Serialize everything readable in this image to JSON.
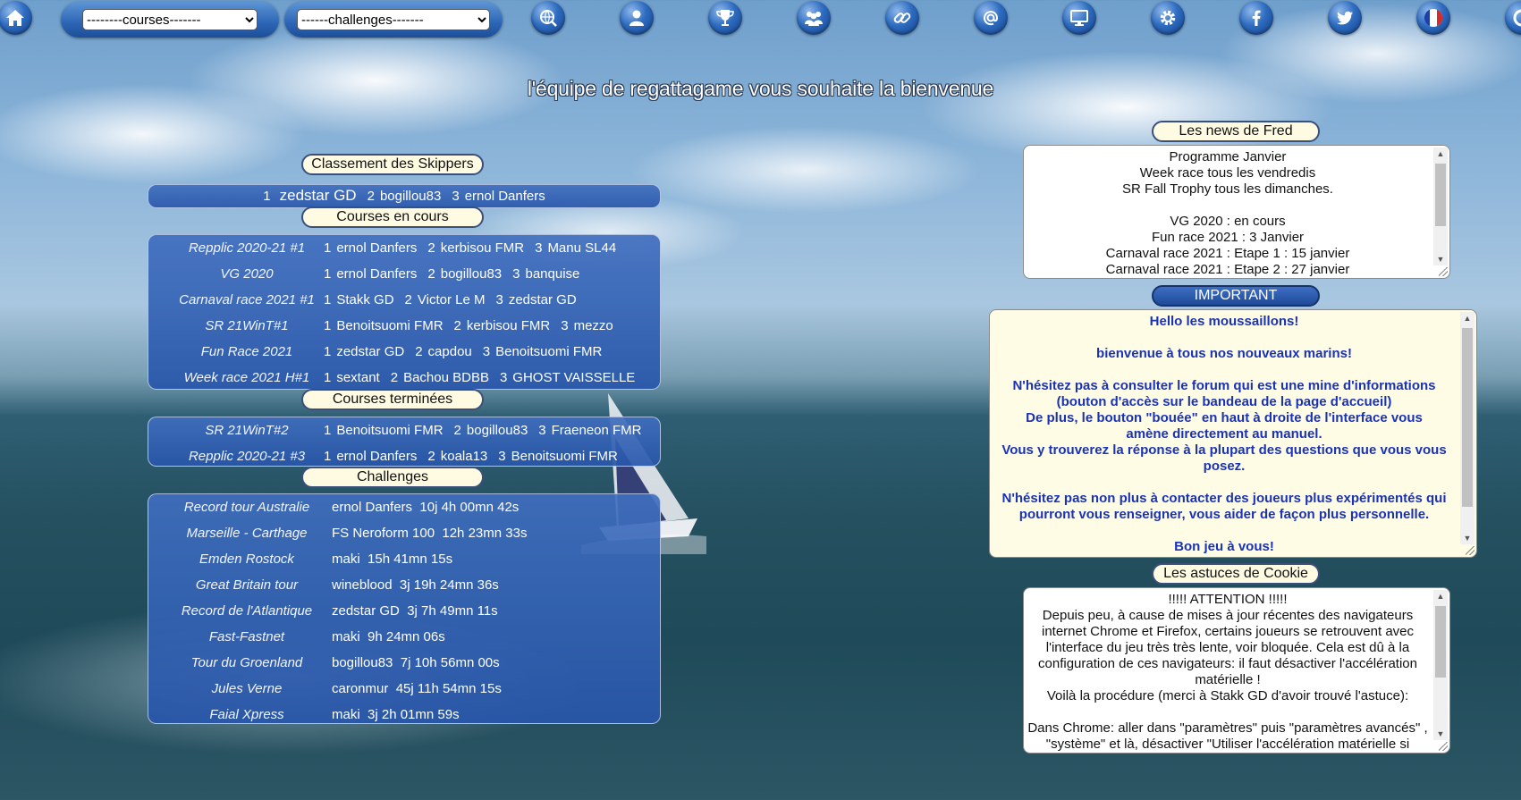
{
  "nav": {
    "courses_select": "--------courses-------",
    "challenges_select": "------challenges-------",
    "icons": [
      "home-icon",
      "search-globe-icon",
      "user-icon",
      "trophy-icon",
      "group-icon",
      "link-icon",
      "at-icon",
      "monitor-icon",
      "gear-icon",
      "facebook-icon",
      "twitter-icon",
      "french-flag-icon"
    ]
  },
  "welcome": "l'équipe de regattagame vous souhaite la bienvenue",
  "left": {
    "classement_title": "Classement des Skippers",
    "skippers": [
      {
        "rank": "1",
        "name": "zedstar GD"
      },
      {
        "rank": "2",
        "name": "bogillou83"
      },
      {
        "rank": "3",
        "name": "ernol Danfers"
      }
    ],
    "courses_title": "Courses en cours",
    "courses": [
      {
        "name": "Repplic 2020-21 #1",
        "results": [
          [
            "1",
            "ernol Danfers"
          ],
          [
            "2",
            "kerbisou FMR"
          ],
          [
            "3",
            "Manu SL44"
          ]
        ]
      },
      {
        "name": "VG 2020",
        "results": [
          [
            "1",
            "ernol Danfers"
          ],
          [
            "2",
            "bogillou83"
          ],
          [
            "3",
            "banquise"
          ]
        ]
      },
      {
        "name": "Carnaval race 2021 #1",
        "results": [
          [
            "1",
            "Stakk GD"
          ],
          [
            "2",
            "Victor Le M"
          ],
          [
            "3",
            "zedstar GD"
          ]
        ]
      },
      {
        "name": "SR 21WinT#1",
        "results": [
          [
            "1",
            "Benoitsuomi FMR"
          ],
          [
            "2",
            "kerbisou FMR"
          ],
          [
            "3",
            "mezzo"
          ]
        ]
      },
      {
        "name": "Fun Race 2021",
        "results": [
          [
            "1",
            "zedstar GD"
          ],
          [
            "2",
            "capdou"
          ],
          [
            "3",
            "Benoitsuomi FMR"
          ]
        ]
      },
      {
        "name": "Week race 2021 H#1",
        "results": [
          [
            "1",
            "sextant"
          ],
          [
            "2",
            "Bachou BDBB"
          ],
          [
            "3",
            "GHOST VAISSELLE"
          ]
        ]
      }
    ],
    "terminees_title": "Courses terminées",
    "terminees": [
      {
        "name": "SR 21WinT#2",
        "results": [
          [
            "1",
            "Benoitsuomi FMR"
          ],
          [
            "2",
            "bogillou83"
          ],
          [
            "3",
            "Fraeneon FMR"
          ]
        ]
      },
      {
        "name": "Repplic 2020-21 #3",
        "results": [
          [
            "1",
            "ernol Danfers"
          ],
          [
            "2",
            "koala13"
          ],
          [
            "3",
            "Benoitsuomi FMR"
          ]
        ]
      }
    ],
    "challenges_title": "Challenges",
    "challenges": [
      {
        "name": "Record tour Australie",
        "result": "ernol Danfers  10j 4h 00mn 42s"
      },
      {
        "name": "Marseille - Carthage",
        "result": "FS Neroform 100  12h 23mn 33s"
      },
      {
        "name": "Emden Rostock",
        "result": "maki  15h 41mn 15s"
      },
      {
        "name": "Great Britain tour",
        "result": "wineblood  3j 19h 24mn 36s"
      },
      {
        "name": "Record de l'Atlantique",
        "result": "zedstar GD  3j 7h 49mn 11s"
      },
      {
        "name": "Fast-Fastnet",
        "result": "maki  9h 24mn 06s"
      },
      {
        "name": "Tour du Groenland",
        "result": "bogillou83  7j 10h 56mn 00s"
      },
      {
        "name": "Jules Verne",
        "result": "caronmur  45j 11h 54mn 15s"
      },
      {
        "name": "Faial Xpress",
        "result": "maki  3j 2h 01mn 59s"
      }
    ]
  },
  "right": {
    "news_title": "Les news de Fred",
    "news_lines": [
      "Programme Janvier",
      "Week race tous les vendredis",
      "SR Fall Trophy tous les dimanches.",
      "",
      "VG 2020 : en cours",
      "Fun race 2021 : 3 Janvier",
      "Carnaval race 2021 : Etape 1 : 15 janvier",
      "Carnaval race 2021 : Etape 2 : 27 janvier"
    ],
    "important_title": "IMPORTANT",
    "important_lines": [
      "Hello les moussaillons!",
      "",
      "bienvenue à tous nos nouveaux marins!",
      "",
      "N'hésitez pas à consulter le forum qui est une mine d'informations",
      "(bouton d'accès sur le bandeau de la page d'accueil)",
      "De plus, le bouton \"bouée\" en haut à droite de l'interface vous",
      "amène directement au manuel.",
      "Vous y trouverez la réponse à la plupart des questions que vous vous",
      "posez.",
      "",
      "N'hésitez pas non plus à contacter des joueurs plus expérimentés qui",
      "pourront vous renseigner, vous aider de façon plus personnelle.",
      "",
      "Bon jeu à vous!"
    ],
    "astuces_title": "Les astuces de Cookie",
    "astuces_lines": [
      "!!!!! ATTENTION !!!!!",
      "Depuis peu, à cause de mises à jour récentes des navigateurs",
      "internet Chrome et Firefox, certains joueurs se retrouvent avec",
      "l'interface du jeu très très lente, voir bloquée. Cela est dû à la",
      "configuration de ces navigateurs: il faut désactiver l'accélération",
      "matérielle !",
      "Voilà la procédure (merci à Stakk GD d'avoir trouvé l'astuce):",
      "",
      "Dans Chrome: aller dans \"paramètres\" puis \"paramètres avancés\" ,",
      "\"système\" et là, désactiver \"Utiliser l'accélération matérielle si"
    ]
  }
}
